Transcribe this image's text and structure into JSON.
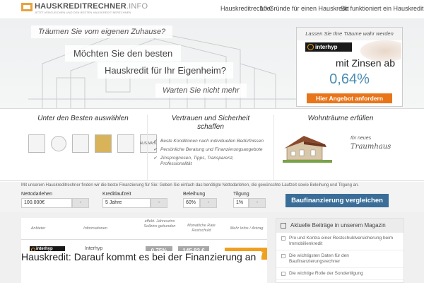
{
  "header": {
    "logo_name_bold": "HAUSKREDITRECHNER",
    "logo_name_light": ".INFO",
    "logo_tagline": "JETZT VERGLEICHEN UND DEN BESTEN HAUSKREDIT BERECHNEN",
    "nav": [
      {
        "label": "Hauskreditrechner"
      },
      {
        "label": "10 Gründe für einen Hauskredit"
      },
      {
        "label": "So funktioniert ein Hauskredit"
      }
    ]
  },
  "hero": {
    "bubble1": "Träumen Sie vom eigenen Zuhause?",
    "bubble2": "Möchten Sie den besten",
    "bubble3": "Hauskredit für Ihr Eigenheim?",
    "bubble4": "Warten Sie nicht mehr",
    "ad": {
      "top_text": "Lassen Sie Ihre Träume wahr werden",
      "logo": "interhyp",
      "rate_text": "mit Zinsen ab",
      "rate": "0,64%",
      "button": "Hier Angebot anfordern"
    }
  },
  "features": {
    "col1_title": "Unter den Besten auswählen",
    "badges": [
      "",
      "",
      "",
      "",
      "",
      "AUSWAHL"
    ],
    "col2_title": "Vertrauen und Sicherheit schaffen",
    "bullets": [
      "Beste Konditionen nach individuellen Bedürfnissen",
      "Persönliche Beratung und Finanzierungsangebote",
      "Zinsprognosen, Tipps, Transparenz, Professionalität"
    ],
    "col3_title": "Wohnträume erfüllen",
    "neues": "Ihr neues",
    "traumhaus": "Traumhaus"
  },
  "calculator": {
    "intro": "Mit unserem Hauskreditrechner finden wir die beste Finanzierung für Sie: Geben Sie einfach das benötigte Nettodarlehen, die gewünschte Laufzeit sowie Beleihung und Tilgung an.",
    "nettodarlehen_label": "Nettodarlehen",
    "nettodarlehen_value": "100.000€",
    "laufzeit_label": "Kreditlaufzeit",
    "laufzeit_value": "5 Jahre",
    "beleihung_label": "Beleihung",
    "beleihung_value": "60%",
    "tilgung_label": "Tilgung",
    "tilgung_value": "1%",
    "dropdown_glyph": "-",
    "button": "Baufinanzierung vergleichen"
  },
  "table": {
    "headers": [
      "Anbieter",
      "Informationen",
      "effekt. Jahreszins Sollzins gebunden",
      "Monatliche Rate Restschuld",
      "Mehr Infos / Antrag"
    ],
    "row": {
      "logo": "interhyp",
      "name": "Interhyp",
      "rate": "0,75%",
      "monthly": "145,83 €",
      "button": "zum Anbieter"
    }
  },
  "article": {
    "title": "Hauskredit: Darauf kommt es bei der Finanzierung an",
    "subtitle": ""
  },
  "sidebar": {
    "title": "Aktuelle Beiträge in unserem Magazin",
    "items": [
      "Pro und Kontra einer Restschuldversicherung beim Immobilienkredit",
      "Die wichtigsten Daten für den Baufinanzierungsrechner",
      "Die wichtige Rolle der Sondertilgung"
    ]
  }
}
